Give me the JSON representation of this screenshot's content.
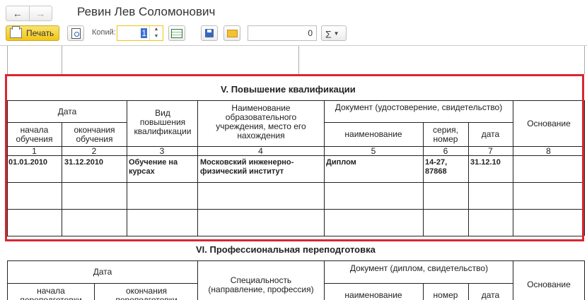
{
  "window": {
    "title": "Ревин Лев Соломонович"
  },
  "nav": {
    "back_icon": "arrow-left-icon",
    "forward_icon": "arrow-right-icon"
  },
  "toolbar": {
    "print_label": "Печать",
    "copies_label": "Копий:",
    "copies_value": "1",
    "number_value": "0",
    "sum_label": "Σ"
  },
  "section5": {
    "title": "V. Повышение квалификации",
    "headers": {
      "date": "Дата",
      "start": "начала обучения",
      "end": "окончания обучения",
      "type": "Вид повышения квалификации",
      "institution": "Наименование образовательного учреждения, место его нахождения",
      "document": "Документ (удостоверение, свидетельство)",
      "doc_name": "наименование",
      "doc_series": "серия, номер",
      "doc_date": "дата",
      "basis": "Основание"
    },
    "col_numbers": [
      "1",
      "2",
      "3",
      "4",
      "5",
      "6",
      "7",
      "8"
    ],
    "row": {
      "start": "01.01.2010",
      "end": "31.12.2010",
      "type": "Обучение на курсах",
      "institution": "Московский инженерно-физический институт",
      "doc_name": "Диплом",
      "doc_series": "14-27, 87868",
      "doc_date": "31.12.10",
      "basis": ""
    }
  },
  "section6": {
    "title": "VI. Профессиональная переподготовка",
    "headers": {
      "date": "Дата",
      "start": "начала переподготовки",
      "end": "окончания переподготовки",
      "specialty": "Специальность (направление, профессия)",
      "document": "Документ (диплом, свидетельство)",
      "doc_name": "наименование",
      "doc_number": "номер",
      "doc_date": "дата",
      "basis": "Основание"
    }
  },
  "colors": {
    "highlight": "#d9262f",
    "print_button": "#f3c916",
    "selected": "#3e6fd6"
  }
}
